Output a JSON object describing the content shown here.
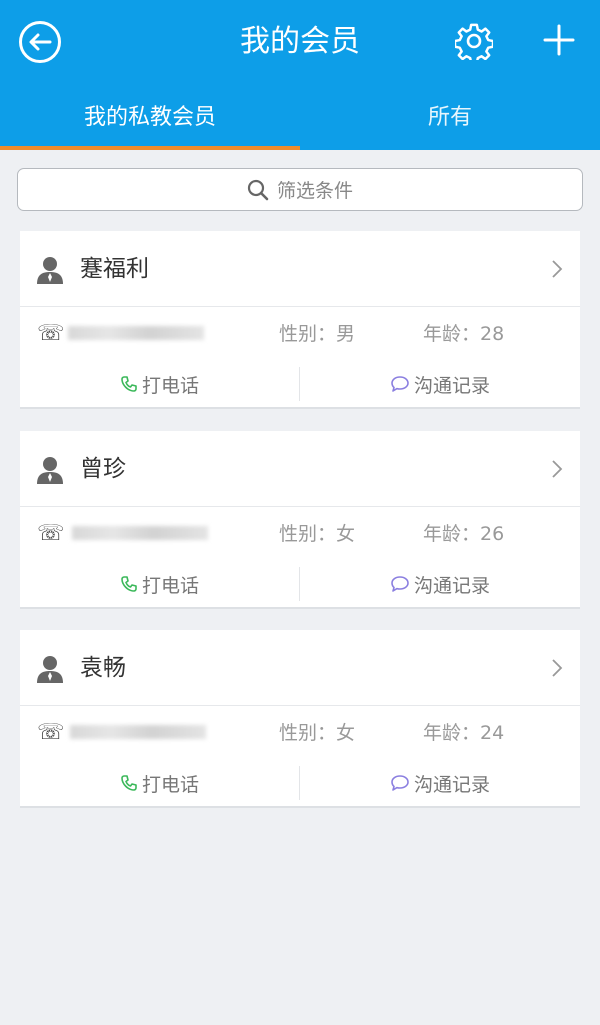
{
  "header": {
    "title": "我的会员",
    "back_icon": "back-arrow-icon",
    "settings_icon": "gear-icon",
    "add_icon": "plus-icon"
  },
  "tabs": [
    {
      "label": "我的私教会员",
      "active": true
    },
    {
      "label": "所有",
      "active": false
    }
  ],
  "search": {
    "placeholder": "筛选条件",
    "icon": "search-icon"
  },
  "members": [
    {
      "name": "蹇福利",
      "gender": "性别：男",
      "age": "年龄：28",
      "call_label": "打电话",
      "log_label": "沟通记录"
    },
    {
      "name": "曾珍",
      "gender": "性别：女",
      "age": "年龄：26",
      "call_label": "打电话",
      "log_label": "沟通记录"
    },
    {
      "name": "袁畅",
      "gender": "性别：女",
      "age": "年龄：24",
      "call_label": "打电话",
      "log_label": "沟通记录"
    }
  ],
  "colors": {
    "header": "#0d9ee8",
    "tab_underline": "#f08c2b",
    "call_icon": "#3bb85a",
    "log_icon": "#8b7fe0"
  }
}
